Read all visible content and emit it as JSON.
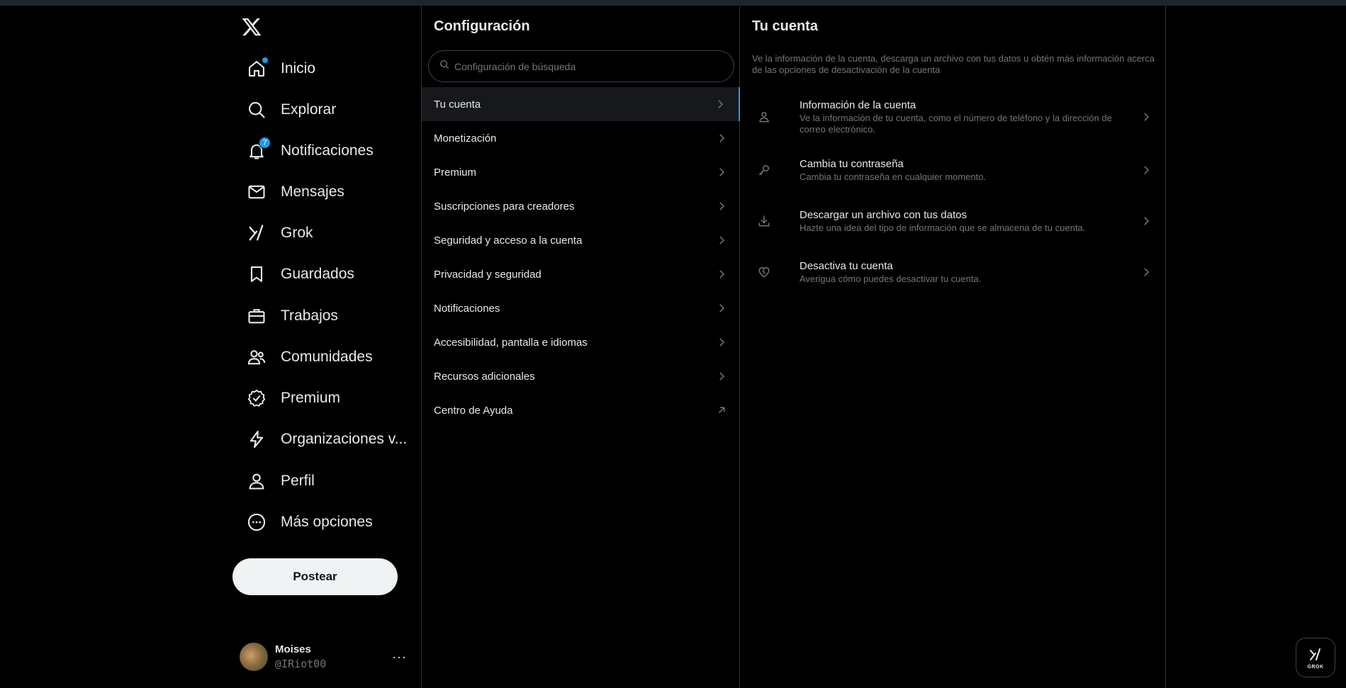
{
  "nav": {
    "items": [
      {
        "label": "Inicio",
        "icon": "home-icon"
      },
      {
        "label": "Explorar",
        "icon": "search-icon"
      },
      {
        "label": "Notificaciones",
        "icon": "bell-icon",
        "badge": "7"
      },
      {
        "label": "Mensajes",
        "icon": "mail-icon"
      },
      {
        "label": "Grok",
        "icon": "grok-icon"
      },
      {
        "label": "Guardados",
        "icon": "bookmark-icon"
      },
      {
        "label": "Trabajos",
        "icon": "briefcase-icon"
      },
      {
        "label": "Comunidades",
        "icon": "people-icon"
      },
      {
        "label": "Premium",
        "icon": "verified-icon"
      },
      {
        "label": "Organizaciones v...",
        "icon": "lightning-icon"
      },
      {
        "label": "Perfil",
        "icon": "person-icon"
      },
      {
        "label": "Más opciones",
        "icon": "more-circle-icon"
      }
    ],
    "post_label": "Postear"
  },
  "account": {
    "name": "Moises",
    "handle": "@IRiot00",
    "more": "···"
  },
  "settings": {
    "title": "Configuración",
    "search_placeholder": "Configuración de búsqueda",
    "items": [
      {
        "label": "Tu cuenta"
      },
      {
        "label": "Monetización"
      },
      {
        "label": "Premium"
      },
      {
        "label": "Suscripciones para creadores"
      },
      {
        "label": "Seguridad y acceso a la cuenta"
      },
      {
        "label": "Privacidad y seguridad"
      },
      {
        "label": "Notificaciones"
      },
      {
        "label": "Accesibilidad, pantalla e idiomas"
      },
      {
        "label": "Recursos adicionales"
      },
      {
        "label": "Centro de Ayuda"
      }
    ]
  },
  "account_panel": {
    "title": "Tu cuenta",
    "description": "Ve la información de la cuenta, descarga un archivo con tus datos u obtén más información acerca de las opciones de desactivación de la cuenta",
    "options": [
      {
        "title": "Información de la cuenta",
        "subtitle": "Ve la información de tu cuenta, como el número de teléfono y la dirección de correo electrónico.",
        "icon": "person-icon"
      },
      {
        "title": "Cambia tu contraseña",
        "subtitle": "Cambia tu contraseña en cualquier momento.",
        "icon": "key-icon"
      },
      {
        "title": "Descargar un archivo con tus datos",
        "subtitle": "Hazte una idea del tipo de información que se almacena de tu cuenta.",
        "icon": "download-icon"
      },
      {
        "title": "Desactiva tu cuenta",
        "subtitle": "Averigua cómo puedes desactivar tu cuenta.",
        "icon": "broken-heart-icon"
      }
    ]
  },
  "grok_fab": {
    "label": "GROK"
  },
  "colors": {
    "accent": "#1d9bf0",
    "background": "#000000",
    "text": "#e7e9ea",
    "muted": "#71767b",
    "border": "#2f3336"
  }
}
